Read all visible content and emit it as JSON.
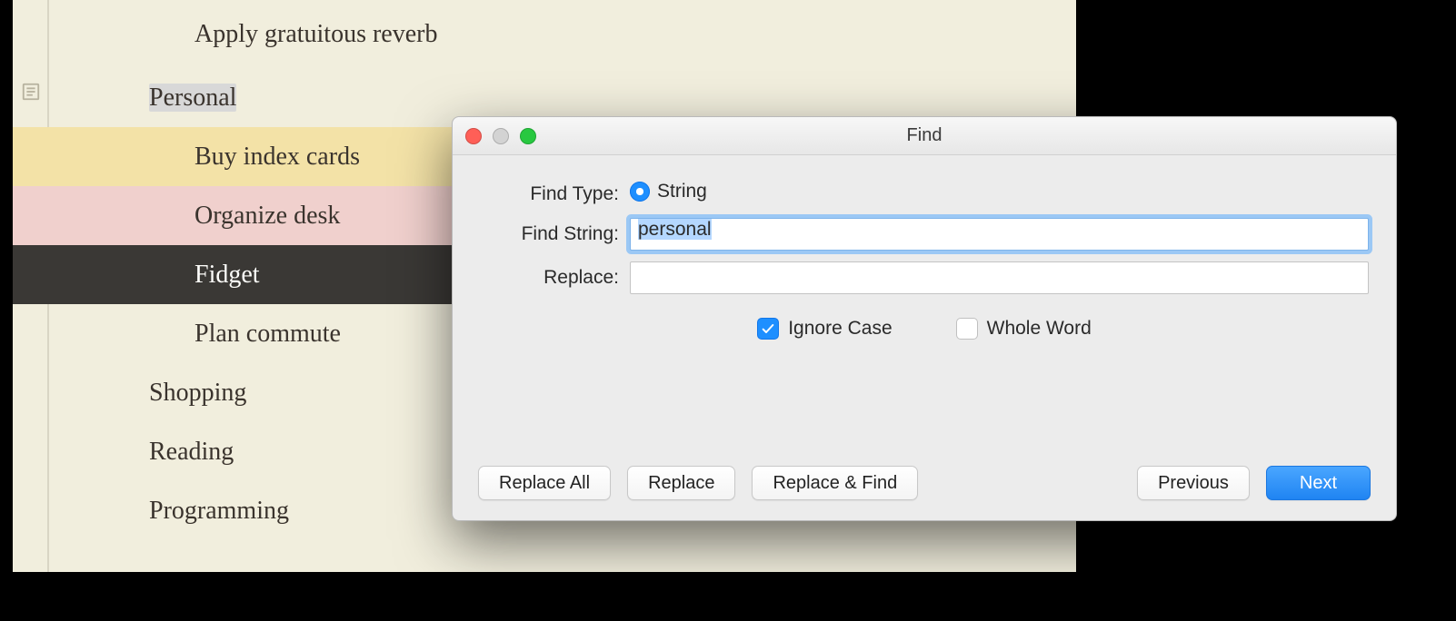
{
  "outline": {
    "items": [
      {
        "text": "Apply gratuitous reverb",
        "indent": 2,
        "style": "plain"
      },
      {
        "text": "Personal",
        "indent": 1,
        "style": "selected",
        "gutter_icon": true
      },
      {
        "text": "Buy index cards",
        "indent": 2,
        "style": "yellow"
      },
      {
        "text": "Organize desk",
        "indent": 2,
        "style": "pink"
      },
      {
        "text": "Fidget",
        "indent": 2,
        "style": "dark"
      },
      {
        "text": "Plan commute",
        "indent": 2,
        "style": "plain"
      },
      {
        "text": "Shopping",
        "indent": 1,
        "style": "plain"
      },
      {
        "text": "Reading",
        "indent": 1,
        "style": "plain"
      },
      {
        "text": "Programming",
        "indent": 1,
        "style": "plain"
      }
    ]
  },
  "find": {
    "title": "Find",
    "labels": {
      "find_type": "Find Type:",
      "find_string": "Find String:",
      "replace": "Replace:"
    },
    "type_option": "String",
    "find_value": "personal",
    "replace_value": "",
    "ignore_case_label": "Ignore Case",
    "ignore_case_checked": true,
    "whole_word_label": "Whole Word",
    "whole_word_checked": false,
    "buttons": {
      "replace_all": "Replace All",
      "replace": "Replace",
      "replace_find": "Replace & Find",
      "previous": "Previous",
      "next": "Next"
    }
  }
}
